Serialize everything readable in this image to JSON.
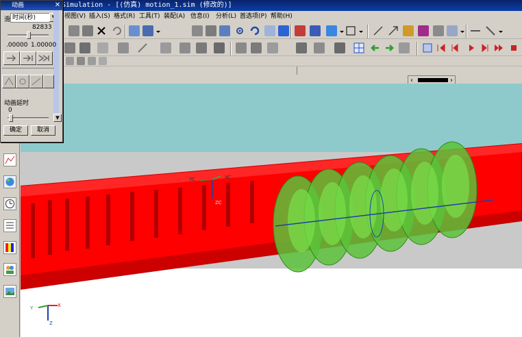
{
  "window": {
    "title": "Simulation - [(仿真) motion_1.sim (修改的)]"
  },
  "menubar": {
    "items": [
      "视图(V)",
      "插入(S)",
      "格式(R)",
      "工具(T)",
      "装配(A)",
      "信息(I)",
      "分析(L)",
      "首选项(P)",
      "帮助(H)"
    ]
  },
  "dialog": {
    "title": "动画",
    "close_glyph": "✕",
    "mode_label": "滑",
    "mode_value": "时间(秒)",
    "current_value": "82833",
    "range_min": ".00000",
    "range_max": "1.00000",
    "delay_label": "动画延时",
    "delay_value": "0",
    "ok_label": "确定",
    "cancel_label": "取消"
  },
  "viewport": {
    "triad_top": {
      "x": "XC",
      "y": "YC",
      "z": "ZC"
    },
    "triad_bottom": {
      "x": "X",
      "y": "Y",
      "z": "Z"
    }
  },
  "colors": {
    "title_bg": "#0a246a",
    "bg_teal": "#8ecacb",
    "bg_gray": "#c9c9c9",
    "red_part": "#ff0000",
    "green_part": "#5cc23a",
    "accent_blue": "#1f3faa"
  },
  "icons": {
    "left_toolbar": [
      "graph-icon",
      "globe-icon",
      "clock-icon",
      "list-icon",
      "colormap-icon",
      "users-icon",
      "image-icon"
    ]
  }
}
